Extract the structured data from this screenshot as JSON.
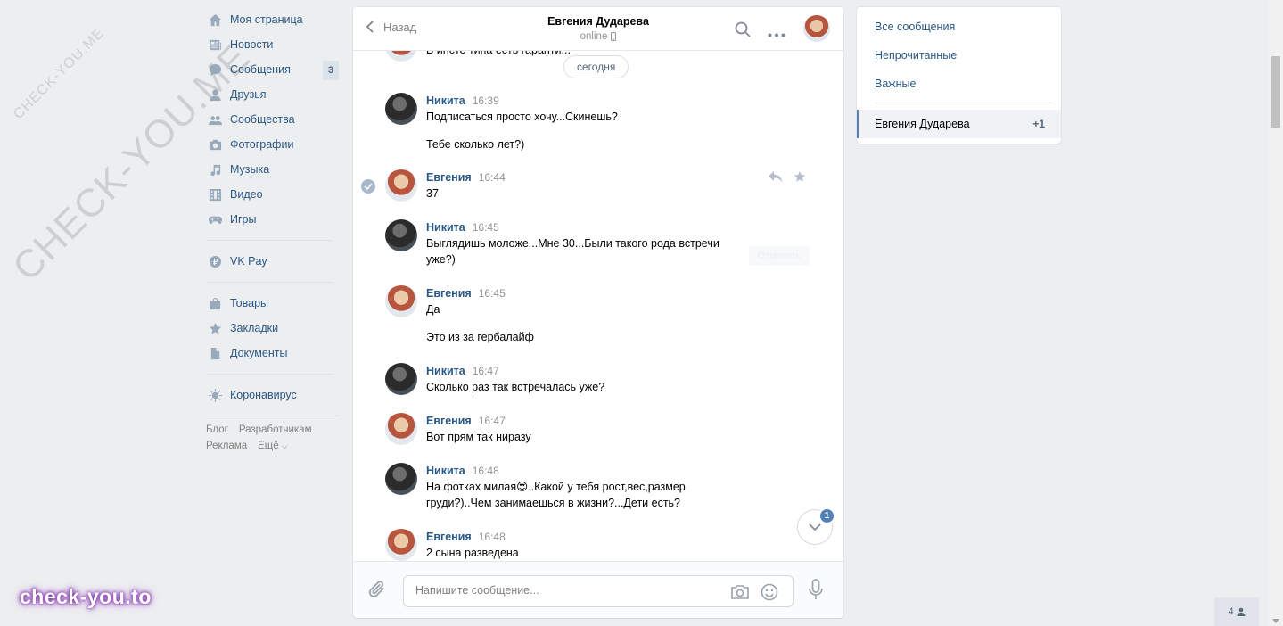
{
  "watermarks": {
    "small": "CHECK-YOU.ME",
    "big": "CHECK-YOU.ME",
    "corner": "check-you.to"
  },
  "nav": {
    "items": [
      {
        "label": "Моя страница",
        "icon": "home-icon"
      },
      {
        "label": "Новости",
        "icon": "news-icon"
      },
      {
        "label": "Сообщения",
        "icon": "messages-icon",
        "badge": "3"
      },
      {
        "label": "Друзья",
        "icon": "friends-icon"
      },
      {
        "label": "Сообщества",
        "icon": "groups-icon"
      },
      {
        "label": "Фотографии",
        "icon": "camera-icon"
      },
      {
        "label": "Музыка",
        "icon": "music-icon"
      },
      {
        "label": "Видео",
        "icon": "video-icon"
      },
      {
        "label": "Игры",
        "icon": "games-icon"
      }
    ],
    "pay": {
      "label": "VK Pay",
      "icon": "vkpay-icon"
    },
    "items2": [
      {
        "label": "Товары",
        "icon": "bag-icon"
      },
      {
        "label": "Закладки",
        "icon": "star-icon"
      },
      {
        "label": "Документы",
        "icon": "document-icon"
      }
    ],
    "corona": {
      "label": "Коронавирус",
      "icon": "virus-icon"
    },
    "footer": {
      "blog": "Блог",
      "dev": "Разработчикам",
      "ads": "Реклама",
      "more": "Ещё"
    }
  },
  "chat": {
    "back_label": "Назад",
    "peer_name": "Евгения Дударева",
    "peer_status": "online",
    "date_pill": "сегодня",
    "ghost_tip": "Отметить",
    "scroll_badge": "1",
    "input_placeholder": "Напишите сообщение...",
    "messages": [
      {
        "partial": "В инсте типа есть гаранти..."
      },
      {
        "author": "Никита",
        "time": "16:39",
        "lines": [
          "Подписаться просто хочу...Скинешь?"
        ],
        "extra": "Тебе сколько лет?)"
      },
      {
        "author": "Евгения",
        "time": "16:44",
        "lines": [
          "37"
        ]
      },
      {
        "author": "Никита",
        "time": "16:45",
        "lines": [
          "Выглядишь моложе...Мне 30...Были такого рода встречи",
          "уже?)"
        ]
      },
      {
        "author": "Евгения",
        "time": "16:45",
        "lines": [
          "Да"
        ],
        "extra": "Это из за гербалайф"
      },
      {
        "author": "Никита",
        "time": "16:47",
        "lines": [
          "Сколько раз так встречалась уже?"
        ]
      },
      {
        "author": "Евгения",
        "time": "16:47",
        "lines": [
          "Вот прям так ниразу"
        ]
      },
      {
        "author": "Никита",
        "time": "16:48",
        "lines": [
          "На фотках милая😍..Какой у тебя рост,вес,размер",
          "груди?)..Чем занимаешься в жизни?...Дети есть?"
        ]
      },
      {
        "author": "Евгения",
        "time": "16:48",
        "lines": [
          "2 сына разведена"
        ]
      }
    ]
  },
  "filters": {
    "all": "Все сообщения",
    "unread": "Непрочитанные",
    "important": "Важные",
    "conversation": {
      "name": "Евгения Дударева",
      "unread": "+1"
    }
  },
  "online_count": "4",
  "colors": {
    "link": "#2a5885",
    "accent": "#5181b8",
    "background": "#edeef0"
  }
}
